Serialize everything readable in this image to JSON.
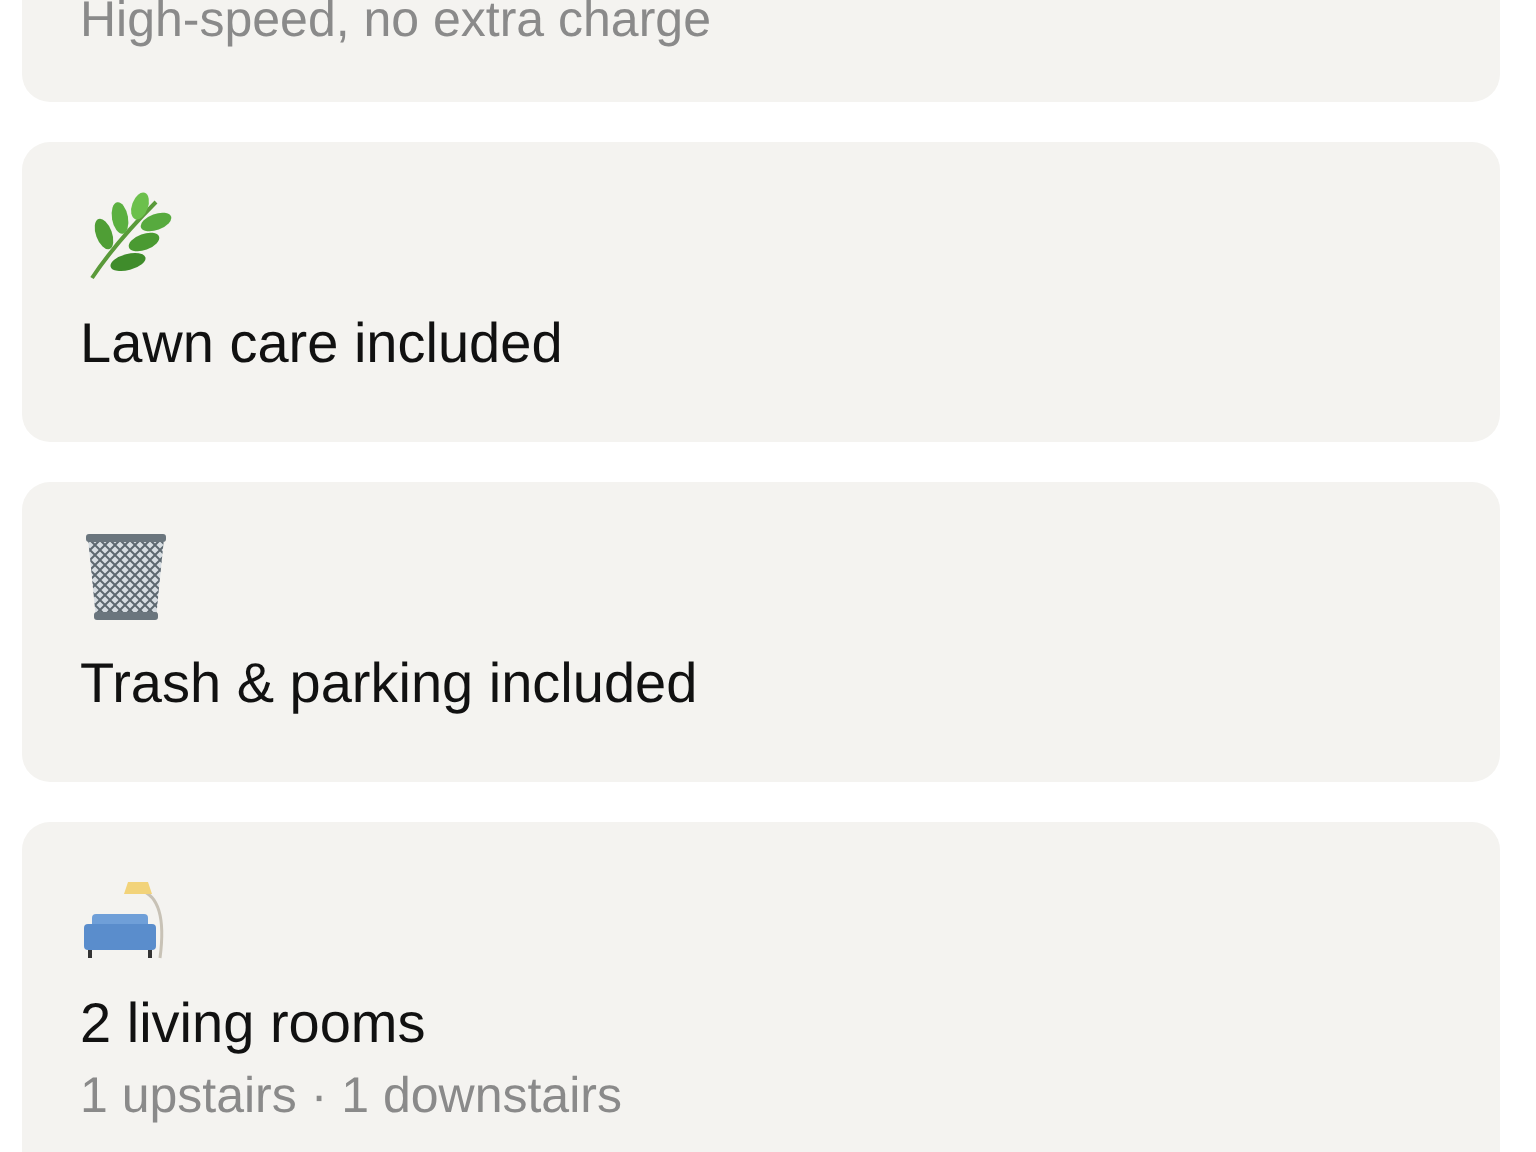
{
  "features": [
    {
      "subtitle": "High-speed, no extra charge"
    },
    {
      "title": "Lawn care included"
    },
    {
      "title": "Trash & parking included"
    },
    {
      "title": "2 living rooms",
      "subtitle": "1 upstairs · 1 downstairs"
    }
  ]
}
